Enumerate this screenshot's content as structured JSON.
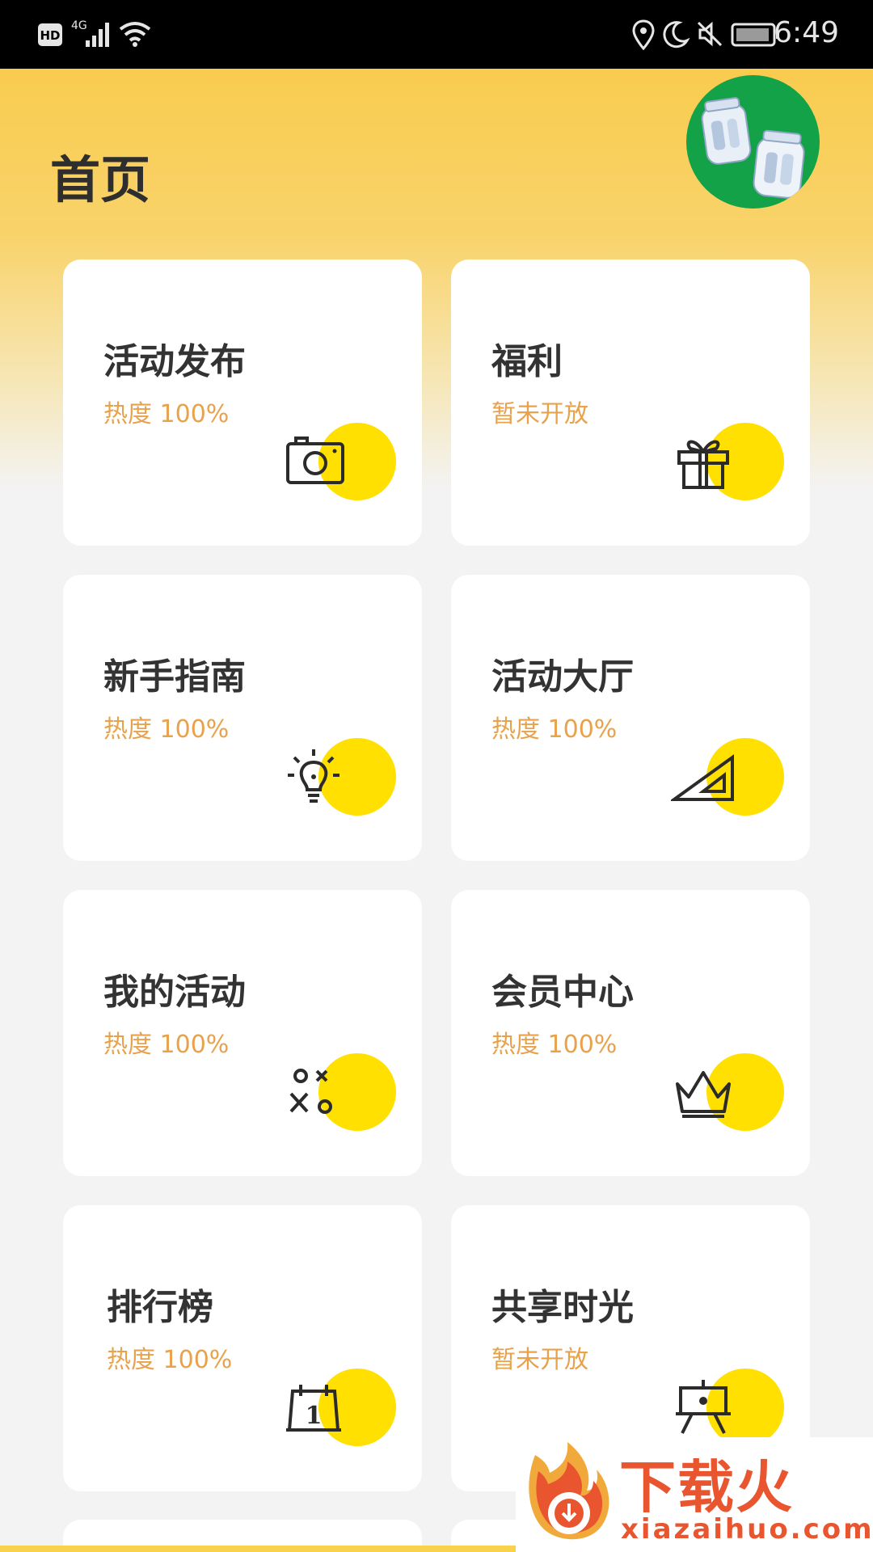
{
  "status_bar": {
    "network_label": "HD",
    "signal_label": "4G",
    "time": "6:49"
  },
  "header": {
    "title": "首页"
  },
  "cards": [
    {
      "title": "活动发布",
      "subtitle": "热度  100%",
      "icon": "camera-icon"
    },
    {
      "title": "福利",
      "subtitle": "暂未开放",
      "icon": "gift-icon"
    },
    {
      "title": "新手指南",
      "subtitle": "热度  100%",
      "icon": "lightbulb-icon"
    },
    {
      "title": "活动大厅",
      "subtitle": "热度  100%",
      "icon": "set-square-icon"
    },
    {
      "title": "我的活动",
      "subtitle": "热度  100%",
      "icon": "tic-tac-toe-icon"
    },
    {
      "title": "会员中心",
      "subtitle": "热度  100%",
      "icon": "crown-icon"
    },
    {
      "title": "排行榜",
      "subtitle": "热度  100%",
      "icon": "calendar-icon"
    },
    {
      "title": "共享时光",
      "subtitle": "暂未开放",
      "icon": "easel-icon"
    }
  ],
  "watermark": {
    "brand": "下载火",
    "url": "xiazaihuo.com"
  },
  "colors": {
    "accent_yellow": "#FFE000",
    "header_gradient_top": "#F9CC4F",
    "subtitle_orange": "#E8A24C",
    "avatar_green": "#13A247",
    "watermark_red": "#E8552E"
  }
}
